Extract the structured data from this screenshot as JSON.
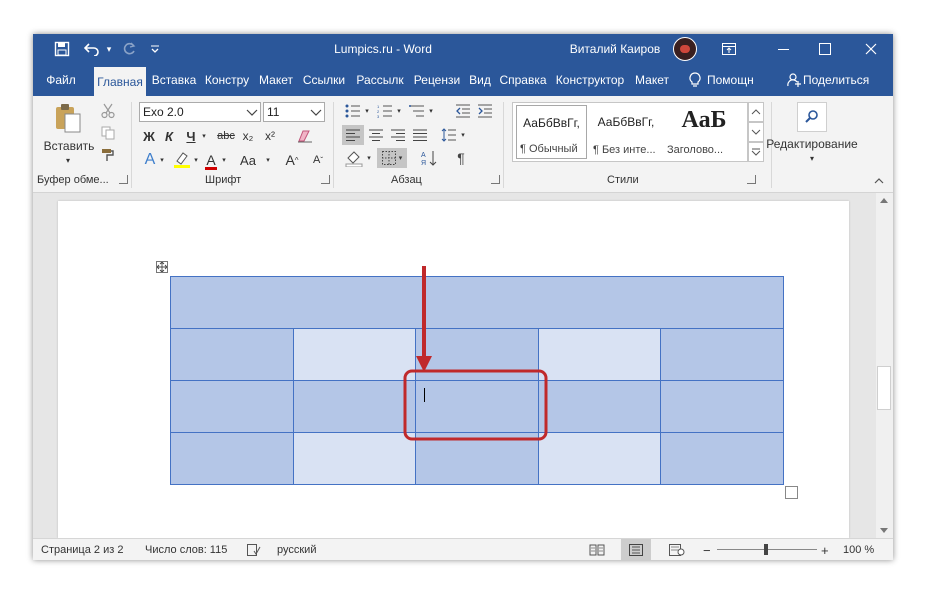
{
  "titlebar": {
    "doc_title": "Lumpics.ru  -  Word",
    "user_name": "Виталий Каиров"
  },
  "tabs": [
    {
      "label": "Файл"
    },
    {
      "label": "Главная",
      "active": true
    },
    {
      "label": "Вставка"
    },
    {
      "label": "Констру"
    },
    {
      "label": "Макет"
    },
    {
      "label": "Ссылки"
    },
    {
      "label": "Рассылк"
    },
    {
      "label": "Рецензи"
    },
    {
      "label": "Вид"
    },
    {
      "label": "Справка"
    },
    {
      "label": "Конструктор"
    },
    {
      "label": "Макет"
    },
    {
      "label": "Помощн"
    },
    {
      "label": "Поделиться"
    }
  ],
  "ribbon": {
    "clipboard": {
      "paste_label": "Вставить",
      "group_label": "Буфер обме..."
    },
    "font": {
      "font_name": "Exo 2.0",
      "font_size": "11",
      "bold": "Ж",
      "italic": "К",
      "underline": "Ч",
      "strike": "abc",
      "subscript": "x₂",
      "superscript": "x²",
      "effects": "A",
      "font_color": "A",
      "change_case": "Aa",
      "grow": "A",
      "shrink": "A",
      "group_label": "Шрифт"
    },
    "paragraph": {
      "pilcrow": "¶",
      "group_label": "Абзац"
    },
    "styles": {
      "items": [
        {
          "preview": "АаБбВвГг,",
          "name": "¶ Обычный"
        },
        {
          "preview": "АаБбВвГг,",
          "name": "¶ Без инте..."
        },
        {
          "preview": "АаБ",
          "name": "Заголово..."
        }
      ],
      "group_label": "Стили"
    },
    "editing": {
      "label": "Редактирование"
    }
  },
  "status": {
    "page": "Страница 2 из 2",
    "words": "Число слов: 115",
    "language": "русский",
    "zoom_level": "100 %",
    "minus": "−",
    "plus": "+"
  },
  "table": {
    "rows": 4,
    "cols": 5,
    "first_row_merged": true
  },
  "colors": {
    "word_blue": "#2b579a",
    "cell_dark": "#b4c6e7",
    "cell_light": "#d9e2f3",
    "cell_border": "#4472c4",
    "annotation_red": "#c0292b"
  }
}
